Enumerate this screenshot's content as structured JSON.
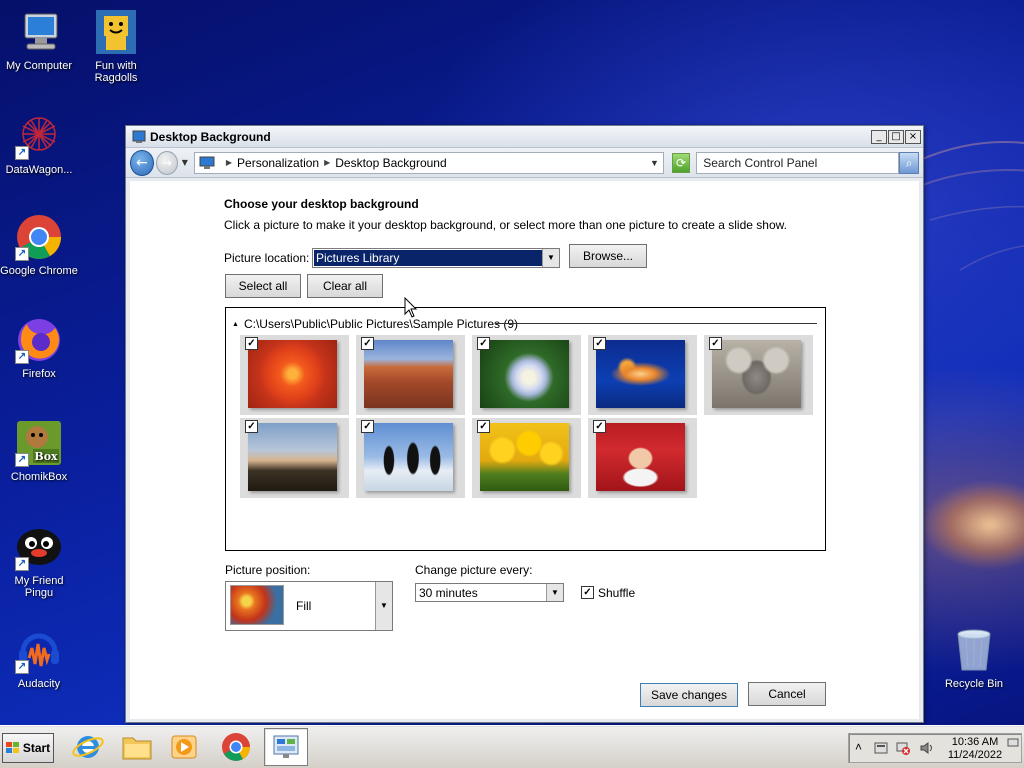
{
  "desktop": {
    "icons": [
      {
        "label": "My Computer"
      },
      {
        "label": "Fun with Ragdolls"
      },
      {
        "label": "DataWagon..."
      },
      {
        "label": "Google Chrome"
      },
      {
        "label": "Firefox"
      },
      {
        "label": "ChomikBox",
        "badge": "Box"
      },
      {
        "label": "My Friend Pingu"
      },
      {
        "label": "Audacity"
      },
      {
        "label": "Recycle Bin"
      }
    ]
  },
  "window": {
    "title": "Desktop Background",
    "controls": {
      "minimize": "_",
      "maximize": "□",
      "close": "×"
    },
    "nav": {
      "breadcrumb": [
        "Personalization",
        "Desktop Background"
      ],
      "search_placeholder": "Search Control Panel"
    },
    "heading": "Choose your desktop background",
    "subtext": "Click a picture to make it your desktop background, or select more than one picture to create a slide show.",
    "picture_location": {
      "label": "Picture location:",
      "value": "Pictures Library"
    },
    "buttons": {
      "browse": "Browse...",
      "select_all": "Select all",
      "clear_all": "Clear all",
      "save": "Save changes",
      "cancel": "Cancel"
    },
    "gallery": {
      "group_title": "C:\\Users\\Public\\Public Pictures\\Sample Pictures (9)",
      "pictures": [
        {
          "name": "chrysanthemum",
          "checked": true
        },
        {
          "name": "desert",
          "checked": true
        },
        {
          "name": "hydrangeas",
          "checked": true
        },
        {
          "name": "jellyfish",
          "checked": true
        },
        {
          "name": "koala",
          "checked": true
        },
        {
          "name": "lighthouse",
          "checked": true
        },
        {
          "name": "penguins",
          "checked": true
        },
        {
          "name": "tulips",
          "checked": true
        },
        {
          "name": "santa",
          "checked": true
        }
      ]
    },
    "picture_position": {
      "label": "Picture position:",
      "value": "Fill"
    },
    "change_every": {
      "label": "Change picture every:",
      "value": "30 minutes"
    },
    "shuffle": {
      "label": "Shuffle",
      "checked": true,
      "mark": "✓"
    }
  },
  "taskbar": {
    "start_label": "Start",
    "apps": [
      "internet-explorer",
      "windows-explorer",
      "media-player",
      "google-chrome",
      "control-panel"
    ],
    "tray": {
      "time": "10:36 AM",
      "date": "11/24/2022",
      "expand": "˄"
    }
  }
}
